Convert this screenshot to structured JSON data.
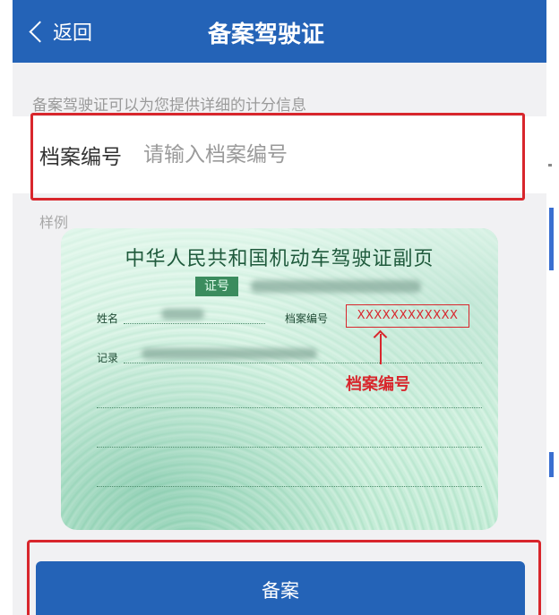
{
  "header": {
    "back_label": "返回",
    "title": "备案驾驶证"
  },
  "form": {
    "hint": "备案驾驶证可以为您提供详细的计分信息",
    "file_number_label": "档案编号",
    "file_number_placeholder": "请输入档案编号",
    "file_number_value": ""
  },
  "sample": {
    "label": "样例",
    "card_title": "中华人民共和国机动车驾驶证副页",
    "seal_text": "证号",
    "name_label": "姓名",
    "file_number_label": "档案编号",
    "record_label": "记录",
    "file_number_value": "XXXXXXXXXXXX",
    "annotation": "档案编号"
  },
  "actions": {
    "submit_label": "备案"
  },
  "colors": {
    "primary": "#2463b7",
    "highlight": "#d8262c",
    "background": "#f1f1f3"
  }
}
